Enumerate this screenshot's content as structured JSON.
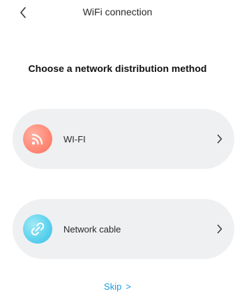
{
  "header": {
    "title": "WiFi connection"
  },
  "heading": "Choose a network distribution method",
  "options": [
    {
      "label": "WI-FI",
      "icon": "wifi-icon",
      "icon_color": "#ff8b78"
    },
    {
      "label": "Network cable",
      "icon": "cable-icon",
      "icon_color": "#5fd3ee"
    }
  ],
  "skip": {
    "label": "Skip",
    "arrow": ">"
  },
  "colors": {
    "card_background": "#eef0f2",
    "link": "#1a9be0"
  }
}
